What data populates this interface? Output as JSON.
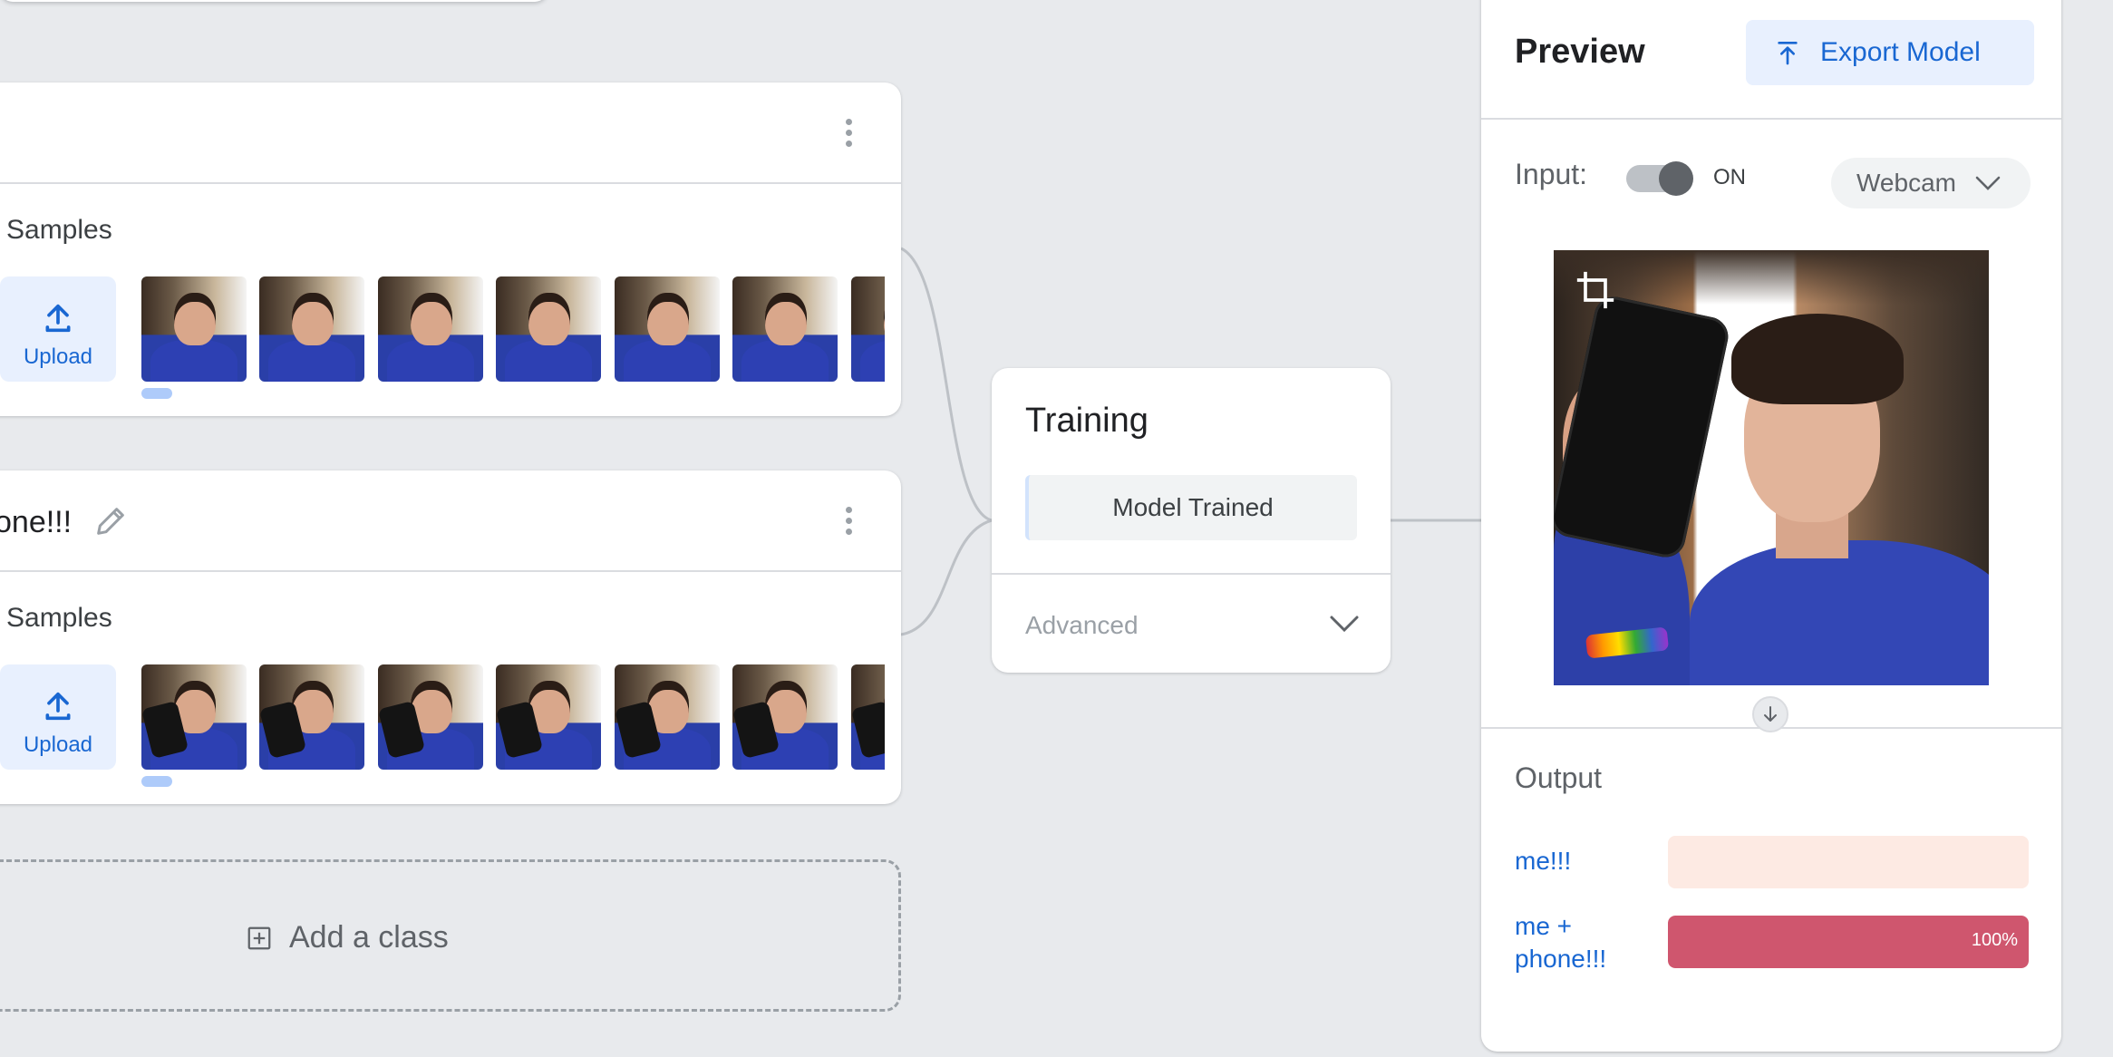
{
  "classes": [
    {
      "name": "",
      "samples_label": "Samples",
      "upload_label": "Upload",
      "thumb_count": 7,
      "with_phone": false
    },
    {
      "name": "one!!!",
      "samples_label": "Samples",
      "upload_label": "Upload",
      "thumb_count": 7,
      "with_phone": true
    }
  ],
  "training": {
    "title": "Training",
    "status": "Model Trained",
    "advanced_label": "Advanced"
  },
  "add_class": {
    "label": "Add a class"
  },
  "preview": {
    "title": "Preview",
    "export_label": "Export Model",
    "input_label": "Input:",
    "toggle_state": "ON",
    "source": "Webcam",
    "output_title": "Output",
    "outputs": [
      {
        "label": "me!!!",
        "value": 0,
        "pct_text": "",
        "color": "#fdeae3"
      },
      {
        "label": "me + phone!!!",
        "value": 100,
        "pct_text": "100%",
        "color": "#cf566e"
      }
    ]
  },
  "colors": {
    "background": "#e8eaed",
    "accent": "#1967d2",
    "upload_tile": "#e8f0fe",
    "output_high": "#cf566e",
    "output_low": "#fdeae3"
  },
  "icons": [
    "upload-icon",
    "kebab-menu-icon",
    "pencil-icon",
    "chevron-down-icon",
    "add-box-icon",
    "export-upload-icon",
    "crop-icon",
    "arrow-down-icon"
  ]
}
